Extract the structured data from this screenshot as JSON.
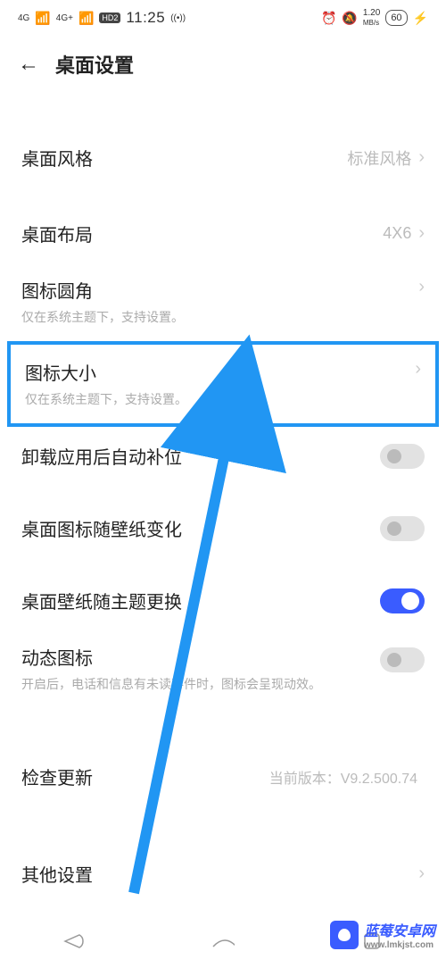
{
  "status": {
    "network1": "4G",
    "network2": "4G+",
    "hd": "HD2",
    "time": "11:25",
    "nfc": "((•))",
    "alarm": "⏰",
    "silent": "🔕",
    "speed_val": "1.20",
    "speed_unit": "MB/s",
    "battery": "60",
    "charging": "⚡"
  },
  "header": {
    "back": "←",
    "title": "桌面设置"
  },
  "rows": {
    "style": {
      "title": "桌面风格",
      "value": "标准风格"
    },
    "layout": {
      "title": "桌面布局",
      "value": "4X6"
    },
    "corner": {
      "title": "图标圆角",
      "desc": "仅在系统主题下，支持设置。"
    },
    "size": {
      "title": "图标大小",
      "desc": "仅在系统主题下，支持设置。"
    },
    "autofill": {
      "title": "卸载应用后自动补位"
    },
    "icon_wall": {
      "title": "桌面图标随壁纸变化"
    },
    "wall_theme": {
      "title": "桌面壁纸随主题更换"
    },
    "dynamic": {
      "title": "动态图标",
      "desc": "开启后，电话和信息有未读事件时，图标会呈现动效。"
    },
    "update": {
      "title": "检查更新",
      "value": "当前版本：V9.2.500.74"
    },
    "other": {
      "title": "其他设置"
    }
  },
  "watermark": {
    "text": "蓝莓安卓网",
    "url": "www.lmkjst.com"
  }
}
